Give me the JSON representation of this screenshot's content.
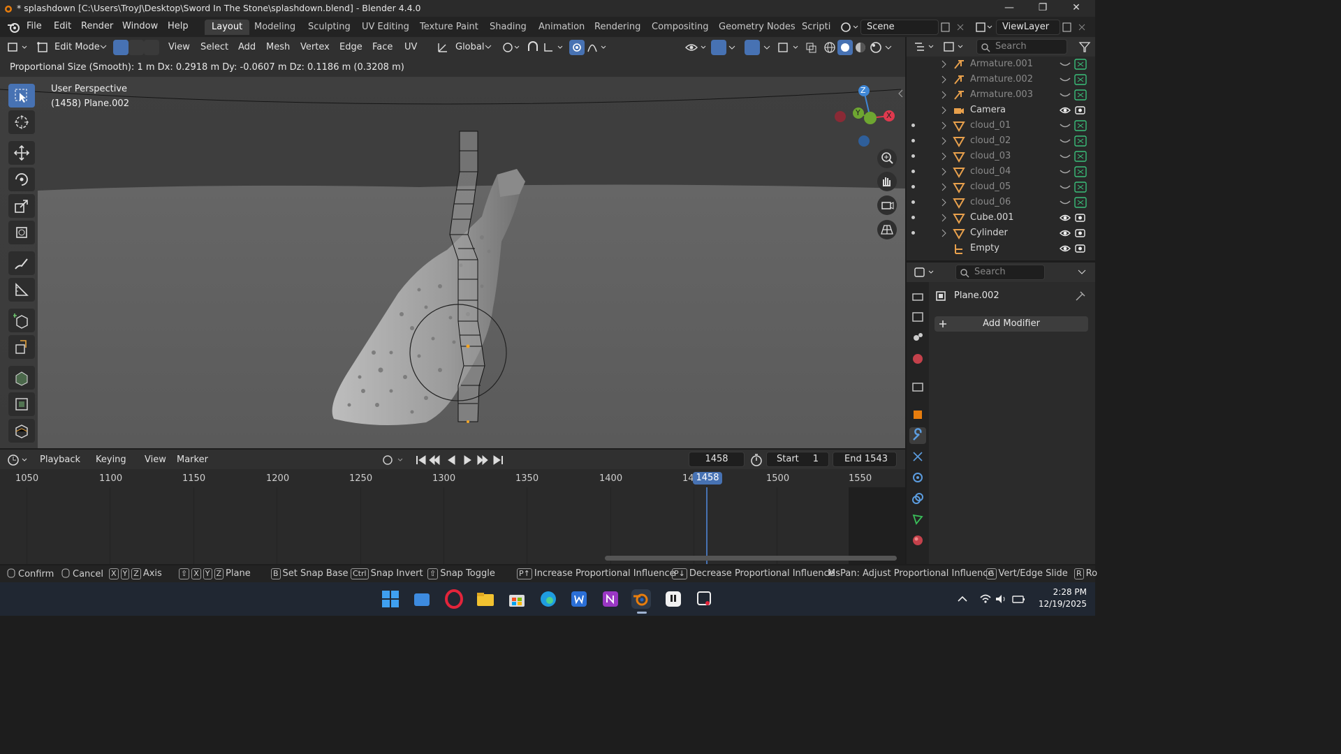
{
  "window": {
    "title": "* splashdown [C:\\Users\\TroyJ\\Desktop\\Sword In The Stone\\splashdown.blend] - Blender 4.4.0",
    "controls": [
      "minimize",
      "restore",
      "close"
    ]
  },
  "menubar": {
    "items": [
      "File",
      "Edit",
      "Render",
      "Window",
      "Help"
    ],
    "workspaces": [
      "Layout",
      "Modeling",
      "Sculpting",
      "UV Editing",
      "Texture Paint",
      "Shading",
      "Animation",
      "Rendering",
      "Compositing",
      "Geometry Nodes",
      "Scripti"
    ],
    "active_workspace": "Layout",
    "scene": "Scene",
    "view_layer": "ViewLayer"
  },
  "viewport_header": {
    "mode": "Edit Mode",
    "menus": [
      "View",
      "Select",
      "Add",
      "Mesh",
      "Vertex",
      "Edge",
      "Face",
      "UV"
    ],
    "transform_orientation": "Global"
  },
  "operator_status": "Proportional Size (Smooth): 1 m   Dx: 0.2918 m   Dy: -0.0607 m   Dz: 0.1186 m (0.3208 m)",
  "viewport": {
    "perspective": "User Perspective",
    "object_info": "(1458) Plane.002",
    "gizmo": {
      "z": "Z",
      "y": "Y",
      "x": "X"
    }
  },
  "timeline": {
    "menus": [
      "Playback",
      "Keying",
      "View",
      "Marker"
    ],
    "current_frame": "1458",
    "start_label": "Start",
    "start": "1",
    "end_label": "End",
    "end": "1543",
    "ticks": [
      "1050",
      "1100",
      "1150",
      "1200",
      "1250",
      "1300",
      "1350",
      "1400",
      "14",
      "1500",
      "1550"
    ],
    "playhead": "1458"
  },
  "statusbar": [
    {
      "keys": [],
      "label": "Confirm"
    },
    {
      "keys": [],
      "label": "Cancel"
    },
    {
      "keys": [
        "X",
        "Y",
        "Z"
      ],
      "label": "Axis"
    },
    {
      "keys": [
        "⇧",
        "X",
        "Y",
        "Z"
      ],
      "label": "Plane"
    },
    {
      "keys": [
        "B"
      ],
      "label": "Set Snap Base"
    },
    {
      "keys": [
        "Ctrl"
      ],
      "label": "Snap Invert"
    },
    {
      "keys": [
        "⇧"
      ],
      "label": "Snap Toggle"
    },
    {
      "keys": [
        "P↑"
      ],
      "label": "Increase Proportional Influence"
    },
    {
      "keys": [
        "P↓"
      ],
      "label": "Decrease Proportional Influence"
    },
    {
      "keys": [],
      "label": "MsPan: Adjust Proportional Influence"
    },
    {
      "keys": [
        "G"
      ],
      "label": "Vert/Edge Slide"
    },
    {
      "keys": [
        "R"
      ],
      "label": "Ro"
    }
  ],
  "outliner": {
    "search_placeholder": "Search",
    "items": [
      {
        "name": "Armature.001",
        "icon": "armature-icon",
        "dim": true
      },
      {
        "name": "Armature.002",
        "icon": "armature-icon",
        "dim": true
      },
      {
        "name": "Armature.003",
        "icon": "armature-icon",
        "dim": true
      },
      {
        "name": "Camera",
        "icon": "camera-icon",
        "dim": false
      },
      {
        "name": "cloud_01",
        "icon": "mesh-icon",
        "dim": true
      },
      {
        "name": "cloud_02",
        "icon": "mesh-icon",
        "dim": true
      },
      {
        "name": "cloud_03",
        "icon": "mesh-icon",
        "dim": true
      },
      {
        "name": "cloud_04",
        "icon": "mesh-icon",
        "dim": true
      },
      {
        "name": "cloud_05",
        "icon": "mesh-icon",
        "dim": true
      },
      {
        "name": "cloud_06",
        "icon": "mesh-icon",
        "dim": true
      },
      {
        "name": "Cube.001",
        "icon": "mesh-icon",
        "dim": false
      },
      {
        "name": "Cylinder",
        "icon": "mesh-icon",
        "dim": false
      },
      {
        "name": "Empty",
        "icon": "empty-icon",
        "dim": false
      }
    ]
  },
  "properties": {
    "search_placeholder": "Search",
    "object_name": "Plane.002",
    "add_modifier": "Add Modifier"
  },
  "taskbar": {
    "time": "2:28 PM",
    "date": "12/19/2025"
  },
  "colors": {
    "accent": "#4772b3",
    "selection_orange": "#f5a623",
    "x_axis": "#e0394e",
    "y_axis": "#6ea631",
    "z_axis": "#3f87d6"
  }
}
